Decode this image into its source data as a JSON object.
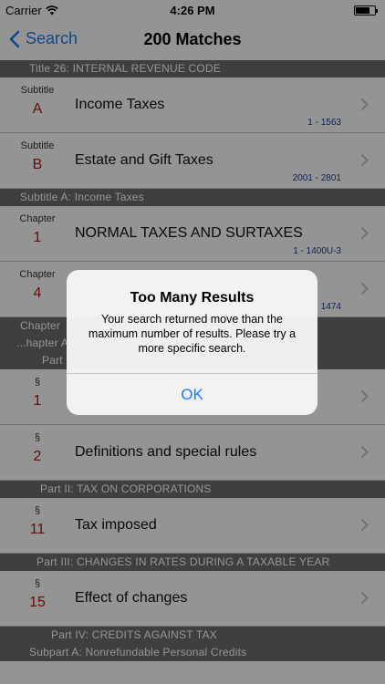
{
  "status_bar": {
    "carrier": "Carrier",
    "time": "4:26 PM"
  },
  "nav": {
    "back_label": "Search",
    "title": "200 Matches"
  },
  "sections": [
    {
      "header": "Title 26: INTERNAL REVENUE CODE",
      "header_sub": "",
      "rows": [
        {
          "kind": "Subtitle",
          "num": "A",
          "title": "Income Taxes",
          "range": "1 - 1563"
        },
        {
          "kind": "Subtitle",
          "num": "B",
          "title": "Estate and Gift Taxes",
          "range": "2001 - 2801"
        }
      ]
    },
    {
      "header": "Subtitle A: Income Taxes",
      "header_sub": "",
      "rows": [
        {
          "kind": "Chapter",
          "num": "1",
          "title": "NORMAL TAXES AND SURTAXES",
          "range": "1 - 1400U-3"
        },
        {
          "kind": "Chapter",
          "num": "4",
          "title": "",
          "range": "1474"
        }
      ]
    },
    {
      "header": "Chapter",
      "header_sub": "...hapter A",
      "header_sub2": "Part",
      "rows": [
        {
          "kind": "§",
          "num": "1",
          "title": "",
          "range": ""
        },
        {
          "kind": "§",
          "num": "2",
          "title": "Definitions and special rules",
          "range": ""
        }
      ]
    },
    {
      "header": "Part II: TAX ON CORPORATIONS",
      "header_sub": "",
      "rows": [
        {
          "kind": "§",
          "num": "11",
          "title": "Tax imposed",
          "range": ""
        }
      ]
    },
    {
      "header": "Part III: CHANGES IN RATES DURING A TAXABLE YEAR",
      "header_sub": "",
      "rows": [
        {
          "kind": "§",
          "num": "15",
          "title": "Effect of changes",
          "range": ""
        }
      ]
    },
    {
      "header": "Part IV: CREDITS AGAINST TAX",
      "header_sub": "Subpart A: Nonrefundable Personal Credits",
      "rows": []
    }
  ],
  "alert": {
    "title": "Too Many Results",
    "message": "Your search returned move than the maximum number of results. Please try a more specific search.",
    "ok_label": "OK"
  },
  "colors": {
    "accent": "#1a7cf7",
    "section_num": "#b01818",
    "range_text": "#1a3f8a",
    "section_header_bg": "#6d6d72"
  }
}
